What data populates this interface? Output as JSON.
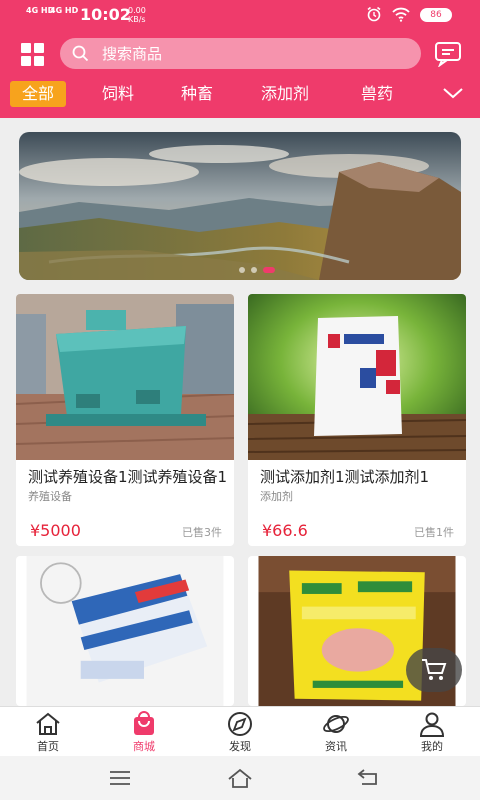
{
  "status_bar": {
    "network1": "4G HD",
    "network2": "4G HD",
    "time": "10:02",
    "speed_value": "0.00",
    "speed_unit": "KB/s",
    "battery": "86"
  },
  "search": {
    "placeholder": "搜索商品"
  },
  "categories": {
    "items": [
      {
        "label": "全部",
        "active": true
      },
      {
        "label": "饲料"
      },
      {
        "label": "种畜"
      },
      {
        "label": "添加剂"
      },
      {
        "label": "兽药"
      }
    ]
  },
  "banner": {
    "slide_count": 3,
    "active_index": 2
  },
  "products": [
    {
      "title": "测试养殖设备1测试养殖设备1",
      "category": "养殖设备",
      "price": "¥5000",
      "sold": "已售3件"
    },
    {
      "title": "测试添加剂1测试添加剂1",
      "category": "添加剂",
      "price": "¥66.6",
      "sold": "已售1件"
    },
    {
      "title": "",
      "category": "",
      "price": "",
      "sold": ""
    },
    {
      "title": "",
      "category": "",
      "price": "",
      "sold": ""
    }
  ],
  "tabbar": {
    "items": [
      {
        "label": "首页",
        "icon": "home-icon"
      },
      {
        "label": "商城",
        "icon": "shopping-bag-icon",
        "active": true
      },
      {
        "label": "发现",
        "icon": "compass-icon"
      },
      {
        "label": "资讯",
        "icon": "planet-icon"
      },
      {
        "label": "我的",
        "icon": "user-icon"
      }
    ]
  },
  "colors": {
    "brand": "#ef3b6b",
    "active_category": "#f7a31d",
    "price": "#e6233a"
  },
  "icons": {
    "status_alarm": "alarm-icon",
    "status_wifi": "wifi-icon",
    "menu": "grid-menu-icon",
    "search": "search-icon",
    "message": "message-icon",
    "expand": "chevron-down-icon",
    "cart": "cart-icon"
  }
}
